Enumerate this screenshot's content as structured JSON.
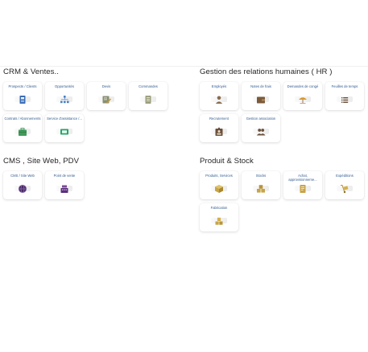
{
  "sections": [
    {
      "title": "CRM & Ventes..",
      "rows": [
        [
          {
            "label": "Prospects / Clients",
            "icon": "id-card-icon"
          },
          {
            "label": "Opportunités",
            "icon": "org-chart-icon"
          },
          {
            "label": "Devis",
            "icon": "edit-document-icon"
          },
          {
            "label": "Commandes",
            "icon": "document-icon"
          }
        ],
        [
          {
            "label": "Contrats / Abonnements",
            "icon": "suitcase-icon"
          },
          {
            "label": "Service d'assistance /...",
            "icon": "ticket-icon"
          }
        ]
      ]
    },
    {
      "title": "Gestion des relations humaines ( HR )",
      "rows": [
        [
          {
            "label": "Employés",
            "icon": "user-icon"
          },
          {
            "label": "Notes de frais",
            "icon": "wallet-icon"
          },
          {
            "label": "Demandes de congé",
            "icon": "umbrella-icon"
          },
          {
            "label": "Feuilles de temps",
            "icon": "list-icon"
          }
        ],
        [
          {
            "label": "Recrutement",
            "icon": "id-badge-icon"
          },
          {
            "label": "Gestion association",
            "icon": "users-icon"
          }
        ]
      ]
    },
    {
      "title": "CMS , Site Web, PDV",
      "rows": [
        [
          {
            "label": "CMS / Site Web",
            "icon": "globe-icon"
          },
          {
            "label": "Point de vente",
            "icon": "cash-register-icon"
          }
        ]
      ]
    },
    {
      "title": "Produit & Stock",
      "rows": [
        [
          {
            "label": "Produits, Services",
            "icon": "cube-icon"
          },
          {
            "label": "Stocks",
            "icon": "boxes-icon"
          },
          {
            "label": "Achat, approvisionneme...",
            "icon": "invoice-icon"
          },
          {
            "label": "Expéditions",
            "icon": "dolly-icon"
          }
        ],
        [
          {
            "label": "Fabrication",
            "icon": "cubes-icon"
          }
        ]
      ]
    }
  ]
}
